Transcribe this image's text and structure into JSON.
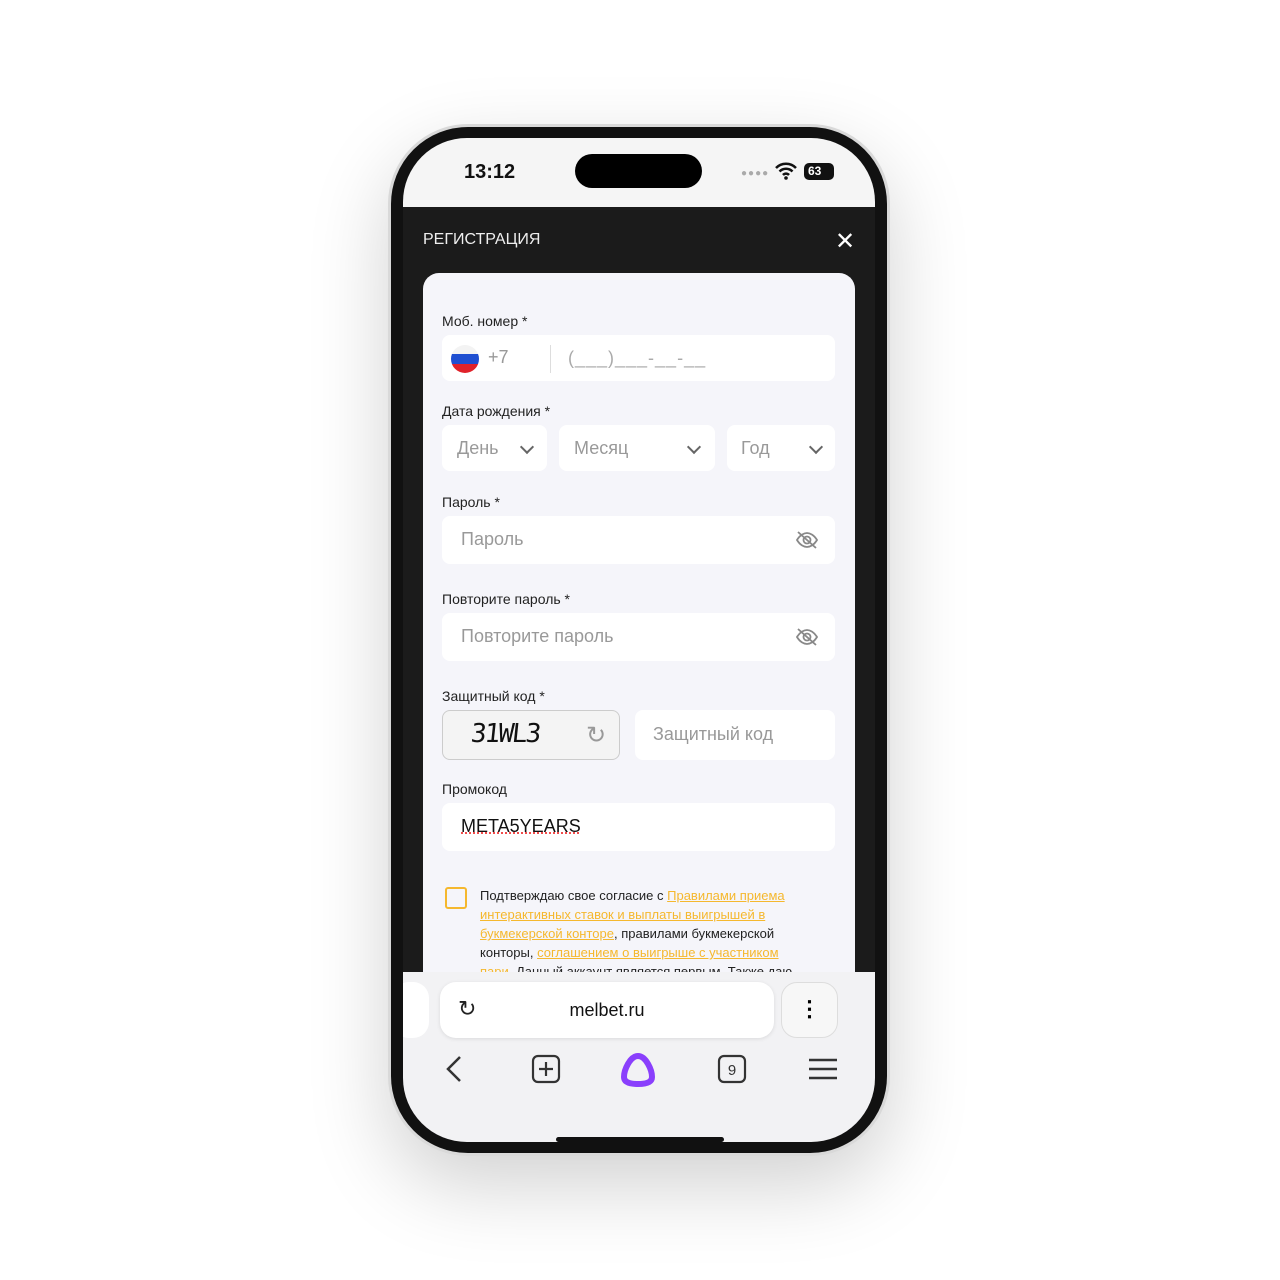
{
  "status": {
    "time": "13:12",
    "battery": "63"
  },
  "header": {
    "title": "РЕГИСТРАЦИЯ",
    "close_icon": "close-icon"
  },
  "form": {
    "phone": {
      "label": "Моб. номер *",
      "country_code": "+7",
      "placeholder": "(___)___-__-__"
    },
    "birth": {
      "label": "Дата рождения *",
      "day": "День",
      "month": "Месяц",
      "year": "Год"
    },
    "password": {
      "label": "Пароль *",
      "placeholder": "Пароль"
    },
    "repeat": {
      "label": "Повторите пароль *",
      "placeholder": "Повторите пароль"
    },
    "captcha": {
      "label": "Защитный код *",
      "image_text": "31WL3",
      "placeholder": "Защитный код"
    },
    "promo": {
      "label": "Промокод",
      "value": "META5YEARS"
    },
    "terms": {
      "t1": "Подтверждаю свое согласие с ",
      "l1": "Правилами приема интерактивных ставок и выплаты выигрышей в букмекерской конторе",
      "t2": ", правилами букмекерской конторы, ",
      "l2": "соглашением о выигрыше с участником пари",
      "t3": ". Данный аккаунт является первым. Также даю"
    }
  },
  "browser": {
    "url": "melbet.ru",
    "tabs_count": "9"
  },
  "colors": {
    "accent": "#f5b82e",
    "header_bg": "#1b1b1b",
    "alice": "#8a3ffc"
  }
}
